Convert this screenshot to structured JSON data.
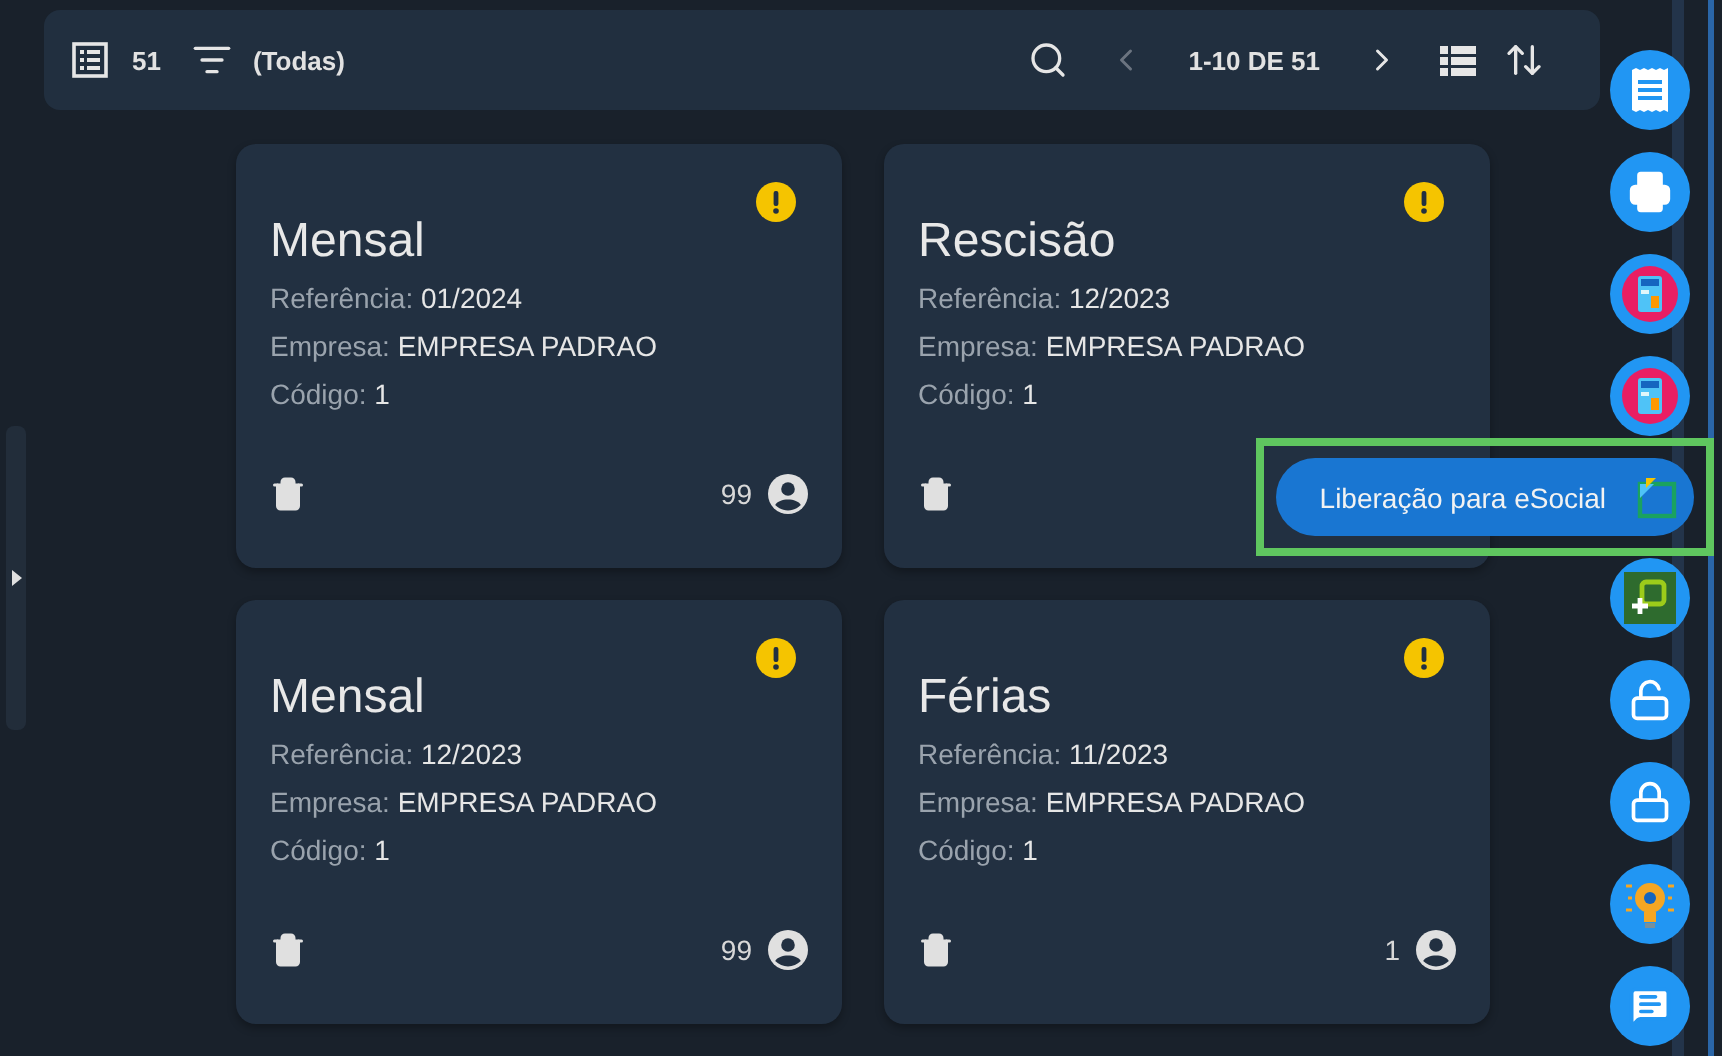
{
  "toolbar": {
    "count": "51",
    "filter": "(Todas)",
    "pagination": "1-10 DE 51",
    "prev_disabled": true,
    "next_disabled": false
  },
  "cards": [
    {
      "title": "Mensal",
      "warning": true,
      "fields": [
        {
          "label": "Referência:",
          "value": "01/2024"
        },
        {
          "label": "Empresa:",
          "value": "EMPRESA PADRAO"
        },
        {
          "label": "Código:",
          "value": "1"
        }
      ],
      "count": "99"
    },
    {
      "title": "Rescisão",
      "warning": true,
      "fields": [
        {
          "label": "Referência:",
          "value": "12/2023"
        },
        {
          "label": "Empresa:",
          "value": "EMPRESA PADRAO"
        },
        {
          "label": "Código:",
          "value": "1"
        }
      ]
    },
    {
      "title": "Mensal",
      "warning": true,
      "fields": [
        {
          "label": "Referência:",
          "value": "12/2023"
        },
        {
          "label": "Empresa:",
          "value": "EMPRESA PADRAO"
        },
        {
          "label": "Código:",
          "value": "1"
        }
      ],
      "count": "99"
    },
    {
      "title": "Férias",
      "warning": true,
      "fields": [
        {
          "label": "Referência:",
          "value": "11/2023"
        },
        {
          "label": "Empresa:",
          "value": "EMPRESA PADRAO"
        },
        {
          "label": "Código:",
          "value": "1"
        }
      ],
      "count": "1"
    }
  ],
  "actions": [
    {
      "kind": "receipt",
      "highlighted": false
    },
    {
      "kind": "printer",
      "highlighted": false
    },
    {
      "kind": "calculator",
      "highlighted": false
    },
    {
      "kind": "calculator",
      "highlighted": false
    },
    {
      "kind": "document",
      "label": "Liberação para eSocial",
      "highlighted": true
    },
    {
      "kind": "add-box",
      "highlighted": false
    },
    {
      "kind": "unlock",
      "highlighted": false
    },
    {
      "kind": "lock",
      "highlighted": false
    },
    {
      "kind": "bulb",
      "highlighted": false
    },
    {
      "kind": "message",
      "highlighted": false
    }
  ]
}
